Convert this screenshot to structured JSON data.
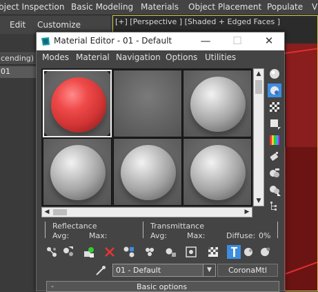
{
  "app_menu": [
    "bject Inspection",
    "Basic Modeling",
    "Materials",
    "Object Placement",
    "Populate",
    "V"
  ],
  "app_toolbar": {
    "edit": "Edit",
    "customize": "Customize"
  },
  "scene_explorer": {
    "sort_label": "cending)",
    "selected_row": "01"
  },
  "viewport": {
    "label": "[+] [Perspective ] [Shaded + Edged Faces ]"
  },
  "material_editor": {
    "title": "Material Editor - 01 - Default",
    "window_buttons": {
      "minimize": "—",
      "maximize": "☐",
      "close": "✕"
    },
    "menu": [
      "Modes",
      "Material",
      "Navigation",
      "Options",
      "Utilities"
    ],
    "slots": [
      {
        "color": "red",
        "selected": true
      },
      {
        "color": "none",
        "selected": false
      },
      {
        "color": "gray",
        "selected": false
      },
      {
        "color": "gray",
        "selected": false
      },
      {
        "color": "gray",
        "selected": false
      },
      {
        "color": "gray",
        "selected": false
      }
    ],
    "reflectance": {
      "title": "Reflectance",
      "avg": "Avg:",
      "max": "Max:"
    },
    "transmittance": {
      "title": "Transmittance",
      "avg": "Avg:",
      "max": "Max:",
      "diffuse": "Diffuse:",
      "diffuse_value": "0%"
    },
    "material_name": "01 - Default",
    "material_type": "CoronaMtl",
    "rollout_toggle": "-",
    "rollout_title": "Basic options"
  },
  "colors": {
    "accent_selected": "#3d8ee0",
    "viewport_border": "#cfc94a",
    "red_object": "#8a1d1d"
  }
}
